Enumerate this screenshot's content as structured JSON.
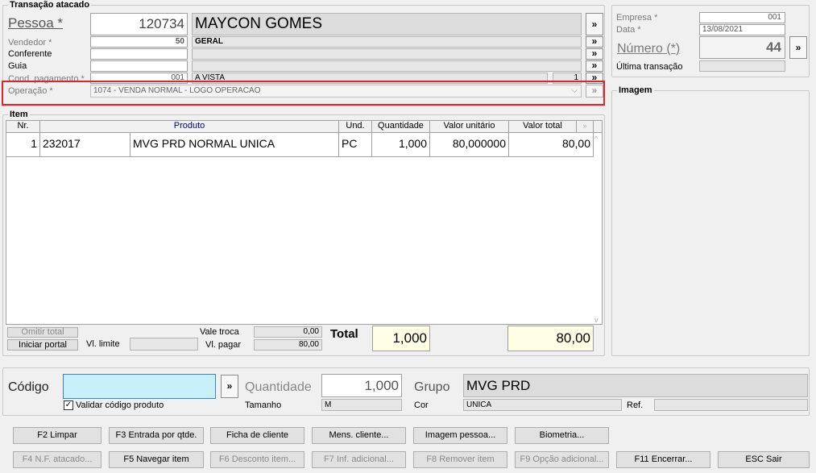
{
  "transacao": {
    "title": "Transação atacado",
    "pessoa_label": "Pessoa *",
    "pessoa_code": "120734",
    "pessoa_name": "MAYCON GOMES",
    "vendedor_label": "Vendedor *",
    "vendedor_code": "50",
    "vendedor_name": "GERAL",
    "conferente_label": "Conferente",
    "guia_label": "Guia",
    "cond_label": "Cond. pagamento *",
    "cond_code": "001",
    "cond_name": "A VISTA",
    "cond_num": "1",
    "operacao_label": "Operação *",
    "operacao_value": "1074 - VENDA NORMAL - LOGO OPERACAO"
  },
  "side": {
    "empresa_label": "Empresa *",
    "empresa_value": "001",
    "data_label": "Data *",
    "data_value": "13/08/2021",
    "numero_label": "Número (*)",
    "numero_value": "44",
    "ultima_label": "Última transação",
    "imagem_title": "Imagem"
  },
  "item": {
    "title": "Item",
    "columns": [
      "Nr.",
      "Produto",
      "Und.",
      "Quantidade",
      "Valor unitário",
      "Valor total"
    ],
    "row": {
      "nr": "1",
      "codigo": "232017",
      "produto": "MVG PRD NORMAL UNICA",
      "und": "PC",
      "quantidade": "1,000",
      "valor_unitario": "80,000000",
      "valor_total": "80,00"
    }
  },
  "totals": {
    "omitir_total": "Omitir total",
    "iniciar_portal": "Iniciar portal",
    "vl_limite_label": "Vl. limite",
    "vale_troca_label": "Vale troca",
    "vale_troca_value": "0,00",
    "vl_pagar_label": "Vl. pagar",
    "vl_pagar_value": "80,00",
    "total_label": "Total",
    "total_qty": "1,000",
    "total_value": "80,00"
  },
  "entry": {
    "codigo_label": "Código",
    "validar_label": "Validar código produto",
    "quantidade_label": "Quantidade",
    "quantidade_value": "1,000",
    "tamanho_label": "Tamanho",
    "tamanho_value": "M",
    "grupo_label": "Grupo",
    "grupo_value": "MVG PRD",
    "cor_label": "Cor",
    "cor_value": "UNICA",
    "ref_label": "Ref."
  },
  "buttons": {
    "f2": "F2 Limpar",
    "f3": "F3 Entrada por qtde.",
    "ficha": "Ficha de cliente",
    "mens": "Mens. cliente...",
    "imagem": "Imagem pessoa...",
    "biometria": "Biometria...",
    "f4": "F4 N.F. atacado...",
    "f5": "F5 Navegar item",
    "f6": "F6 Desconto item...",
    "f7": "F7 Inf. adicional...",
    "f8": "F8 Remover item",
    "f9": "F9 Opção adicional...",
    "f11": "F11 Encerrar...",
    "esc": "ESC Sair"
  },
  "arrow": "»",
  "colors": {
    "highlight": "#e0242a",
    "codigo_bg": "#c8f0f8",
    "total_bg": "#ffffe6",
    "grid_header_text": "#00007f"
  }
}
